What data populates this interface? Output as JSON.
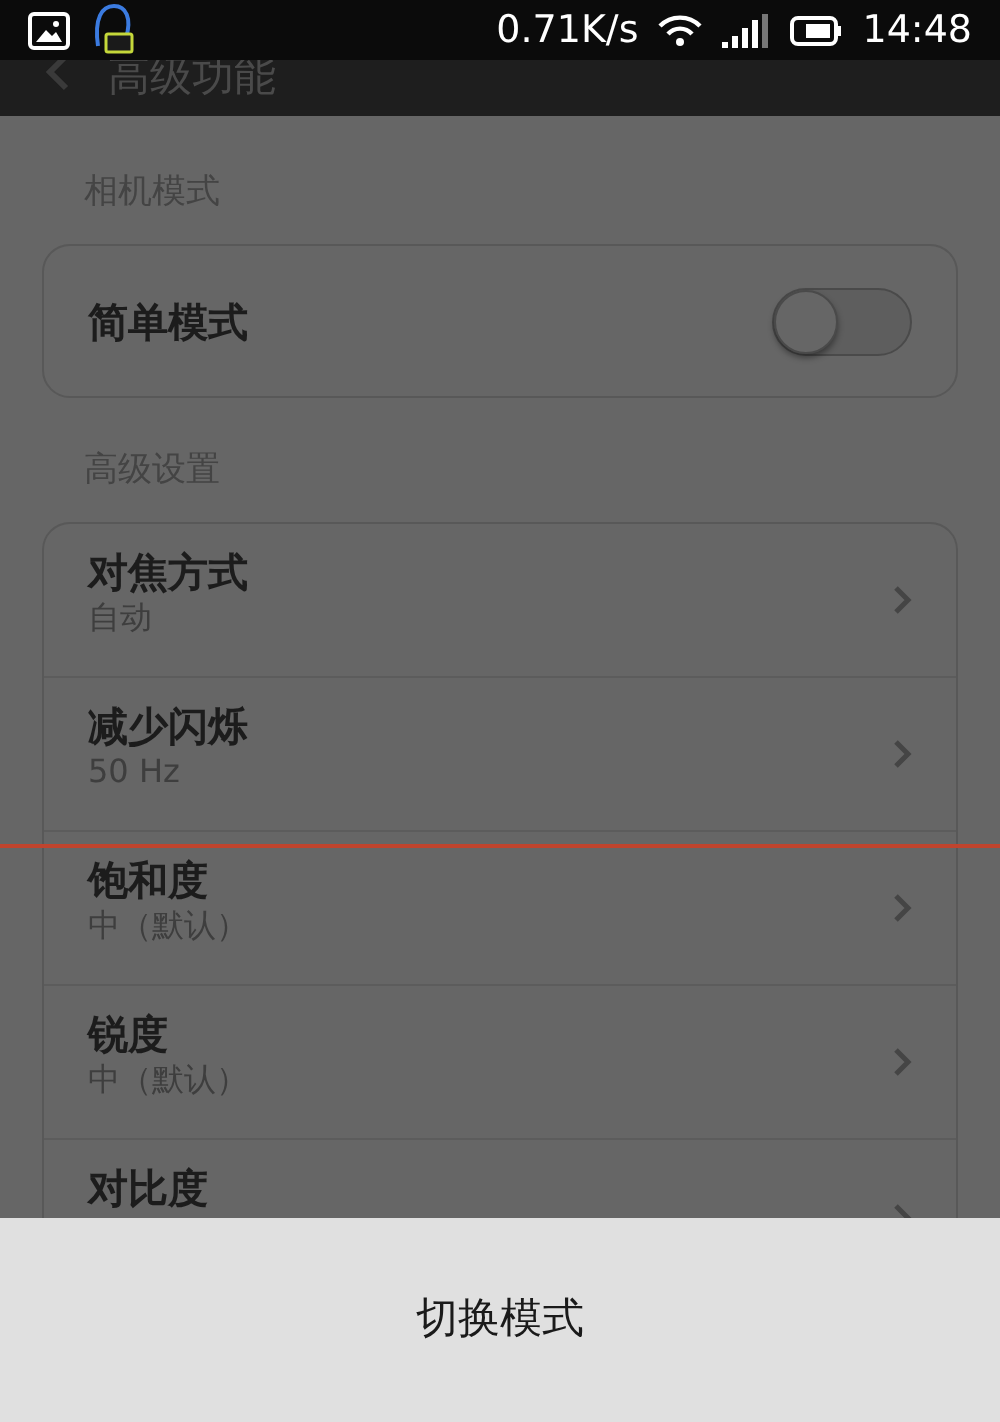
{
  "status_bar": {
    "speed": "0.71K/s",
    "time": "14:48"
  },
  "header": {
    "title": "高级功能"
  },
  "sections": [
    {
      "label": "相机模式",
      "items": [
        {
          "kind": "toggle",
          "title": "简单模式",
          "on": false
        }
      ]
    },
    {
      "label": "高级设置",
      "items": [
        {
          "kind": "link",
          "title": "对焦方式",
          "value": "自动"
        },
        {
          "kind": "link",
          "title": "减少闪烁",
          "value": "50 Hz"
        },
        {
          "kind": "link",
          "title": "饱和度",
          "value": "中（默认）"
        },
        {
          "kind": "link",
          "title": "锐度",
          "value": "中（默认）"
        },
        {
          "kind": "link",
          "title": "对比度"
        }
      ]
    }
  ],
  "sheet": {
    "action": "切换模式"
  }
}
